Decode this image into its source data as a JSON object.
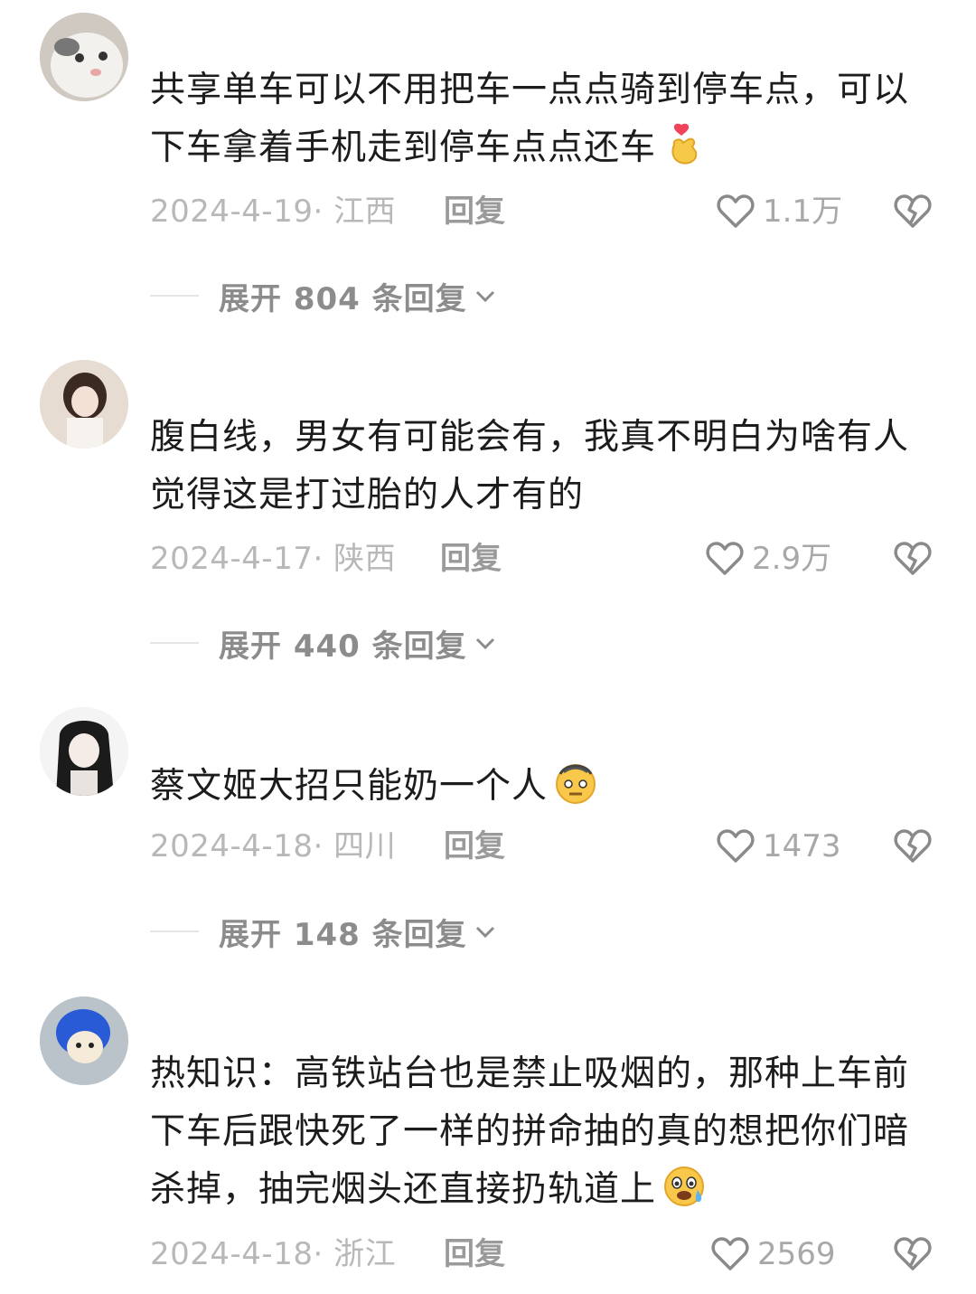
{
  "comments": [
    {
      "text": "共享单车可以不用把车一点点骑到停车点，可以下车拿着手机走到停车点点还车",
      "emoji": "finger-heart-emoji",
      "date": "2024-4-19· 江西",
      "reply": "回复",
      "likes": "1.1万",
      "expand": "展开 804 条回复"
    },
    {
      "text": "腹白线，男女有可能会有，我真不明白为啥有人觉得这是打过胎的人才有的",
      "emoji": "",
      "date": "2024-4-17· 陕西",
      "reply": "回复",
      "likes": "2.9万",
      "expand": "展开 440 条回复"
    },
    {
      "text": "蔡文姬大招只能奶一个人",
      "emoji": "dizzy-face-emoji",
      "date": "2024-4-18· 四川",
      "reply": "回复",
      "likes": "1473",
      "expand": "展开 148 条回复"
    },
    {
      "text": "热知识：高铁站台也是禁止吸烟的，那种上车前下车后跟快死了一样的拼命抽的真的想把你们暗杀掉，抽完烟头还直接扔轨道上",
      "emoji": "crying-sweat-emoji",
      "date": "2024-4-18· 浙江",
      "reply": "回复",
      "likes": "2569",
      "expand": ""
    }
  ],
  "icons": {
    "like": "heart-outline-icon",
    "dislike": "broken-heart-icon",
    "expand": "chevron-down-icon"
  },
  "colors": {
    "text": "#1c1c1c",
    "meta": "#b8b8b8",
    "reply": "#9a9a9a",
    "expand": "#8c8c8c"
  }
}
